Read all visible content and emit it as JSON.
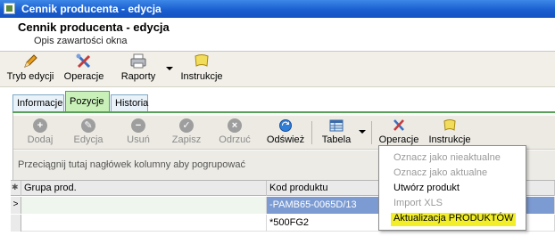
{
  "window": {
    "title": "Cennik producenta - edycja"
  },
  "header": {
    "title": "Cennik producenta - edycja",
    "subtitle": "Opis zawartości okna"
  },
  "main_toolbar": {
    "edit_mode": "Tryb edycji",
    "operations": "Operacje",
    "reports": "Raporty",
    "instructions": "Instrukcje"
  },
  "tabs": [
    {
      "label": "Informacje",
      "active": false
    },
    {
      "label": "Pozycje",
      "active": true
    },
    {
      "label": "Historia",
      "active": false
    }
  ],
  "sub_toolbar": {
    "add": "Dodaj",
    "edit": "Edycja",
    "delete": "Usuń",
    "save": "Zapisz",
    "discard": "Odrzuć",
    "refresh": "Odśwież",
    "table": "Tabela",
    "operations": "Operacje",
    "instructions": "Instrukcje"
  },
  "group_hint": "Przeciągnij tutaj nagłówek kolumny aby pogrupować",
  "grid": {
    "header_marker": "✱",
    "columns": [
      "Grupa prod.",
      "Kod produktu"
    ],
    "rows": [
      {
        "marker": ">",
        "group": "",
        "code": "-PAMB65-0065D/13"
      },
      {
        "marker": "",
        "group": "",
        "code": "*500FG2"
      }
    ]
  },
  "operations_menu": {
    "items": [
      {
        "label": "Oznacz jako nieaktualne",
        "enabled": false
      },
      {
        "label": "Oznacz jako aktualne",
        "enabled": false
      },
      {
        "label": "Utwórz produkt",
        "enabled": true
      },
      {
        "label": "Import XLS",
        "enabled": false
      },
      {
        "label": "Aktualizacja PRODUKTÓW",
        "enabled": true,
        "highlighted": true
      }
    ]
  },
  "colors": {
    "titlebar": "#1a5fd0",
    "active_tab": "#c8f0b8",
    "selection": "#7b9bd2",
    "highlight": "#f2ef2a"
  }
}
